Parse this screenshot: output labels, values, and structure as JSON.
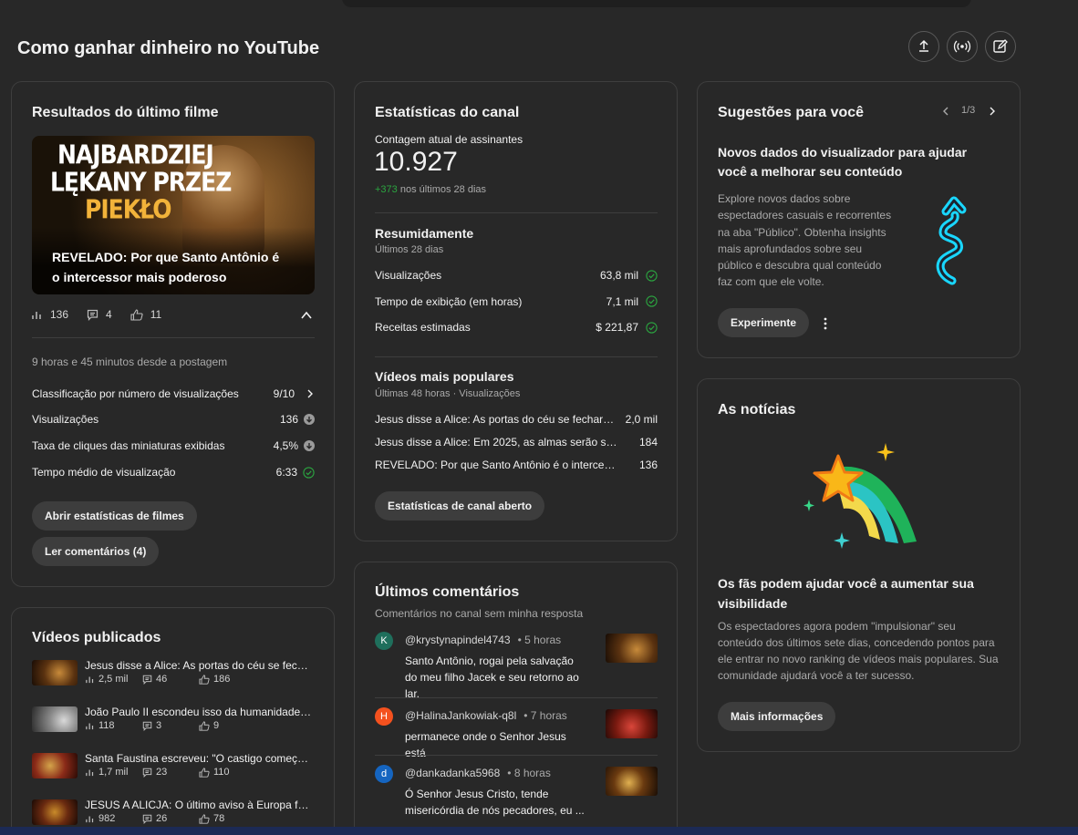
{
  "page": {
    "title": "Como ganhar dinheiro no YouTube"
  },
  "header_actions": [
    {
      "name": "upload-icon"
    },
    {
      "name": "live-broadcast-icon"
    },
    {
      "name": "create-post-icon"
    }
  ],
  "latest": {
    "title": "Resultados do último filme",
    "thumbnail_text": [
      "NAJBARDZIEJ",
      "LĘKANY PRZEZ",
      "PIEKŁO"
    ],
    "video_title": "REVELADO: Por que Santo Antônio é o intercessor mais poderoso",
    "views": "136",
    "comments": "4",
    "likes": "11",
    "posted": "9 horas e 45 minutos desde a postagem",
    "metrics": [
      {
        "label": "Classificação por número de visualizações",
        "value": "9/10",
        "icon": "chevron-right-icon"
      },
      {
        "label": "Visualizações",
        "value": "136",
        "icon": "arrow-down-circle-icon"
      },
      {
        "label": "Taxa de cliques das miniaturas exibidas",
        "value": "4,5%",
        "icon": "arrow-down-circle-icon"
      },
      {
        "label": "Tempo médio de visualização",
        "value": "6:33",
        "icon": "check-circle-icon"
      }
    ],
    "btn_stats": "Abrir estatísticas de filmes",
    "btn_comments": "Ler comentários (4)"
  },
  "published": {
    "title": "Vídeos publicados",
    "videos": [
      {
        "title": "Jesus disse a Alice: As portas do céu se fechara...",
        "views": "2,5 mil",
        "comments": "46",
        "likes": "186"
      },
      {
        "title": "João Paulo II escondeu isso da humanidade: \"...",
        "views": "118",
        "comments": "3",
        "likes": "9"
      },
      {
        "title": "Santa Faustina escreveu: \"O castigo começará ...",
        "views": "1,7 mil",
        "comments": "23",
        "likes": "110"
      },
      {
        "title": "JESUS A ALICJA: O último aviso à Europa foi d...",
        "views": "982",
        "comments": "26",
        "likes": "78"
      }
    ]
  },
  "channel": {
    "title": "Estatísticas do canal",
    "subs_label": "Contagem atual de assinantes",
    "subs_count": "10.927",
    "subs_delta": "+373",
    "subs_delta_suffix": "nos últimos 28 dias",
    "summary_title": "Resumidamente",
    "summary_period": "Últimos 28 dias",
    "summary": [
      {
        "label": "Visualizações",
        "value": "63,8 mil"
      },
      {
        "label": "Tempo de exibição (em horas)",
        "value": "7,1 mil"
      },
      {
        "label": "Receitas estimadas",
        "value": "$ 221,87"
      }
    ],
    "popular_title": "Vídeos mais populares",
    "popular_period": "Últimas 48 horas · Visualizações",
    "popular": [
      {
        "title": "Jesus disse a Alice: As portas do céu se fecharão...",
        "value": "2,0 mil"
      },
      {
        "title": "Jesus disse a Alice: Em 2025, as almas serão sep...",
        "value": "184"
      },
      {
        "title": "REVELADO: Por que Santo Antônio é o intercessor...",
        "value": "136"
      }
    ],
    "btn_open": "Estatísticas de canal aberto"
  },
  "comments": {
    "title": "Últimos comentários",
    "subtitle": "Comentários no canal sem minha resposta",
    "items": [
      {
        "initial": "K",
        "color": "#1f6f5c",
        "user": "@krystynapindel4743",
        "time": "• 5 horas",
        "text": "Santo Antônio, rogai pela salvação do meu filho Jacek e seu retorno ao lar."
      },
      {
        "initial": "H",
        "color": "#f4511e",
        "user": "@HalinaJankowiak-q8l",
        "time": "• 7 horas",
        "text": "permanece onde o Senhor Jesus está"
      },
      {
        "initial": "d",
        "color": "#1565c0",
        "user": "@dankadanka5968",
        "time": "• 8 horas",
        "text": "Ó Senhor Jesus Cristo, tende misericórdia de nós pecadores, eu ..."
      }
    ]
  },
  "suggestions": {
    "title": "Sugestões para você",
    "pager": "1/3",
    "heading": "Novos dados do visualizador para ajudar você a melhorar seu conteúdo",
    "body": "Explore novos dados sobre espectadores casuais e recorrentes na aba \"Público\". Obtenha insights mais aprofundados sobre seu público e descubra qual conteúdo faz com que ele volte.",
    "btn": "Experimente"
  },
  "news": {
    "title": "As notícias",
    "heading": "Os fãs podem ajudar você a aumentar sua visibilidade",
    "body": "Os espectadores agora podem \"impulsionar\" seu conteúdo dos últimos sete dias, concedendo pontos para ele entrar no novo ranking de vídeos mais populares. Sua comunidade ajudará você a ter sucesso.",
    "btn": "Mais informações"
  }
}
